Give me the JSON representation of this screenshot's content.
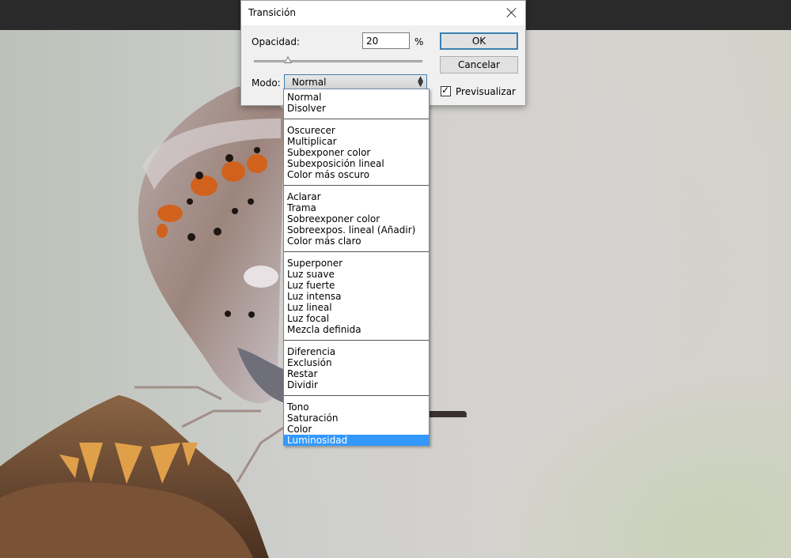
{
  "dialog": {
    "title": "Transición",
    "opacity_label": "Opacidad:",
    "opacity_value": "20",
    "opacity_unit": "%",
    "slider_fraction": 0.2,
    "mode_label": "Modo:",
    "mode_selected": "Normal",
    "ok_label": "OK",
    "cancel_label": "Cancelar",
    "preview_label": "Previsualizar",
    "preview_checked": true
  },
  "dropdown": {
    "groups": [
      [
        "Normal",
        "Disolver"
      ],
      [
        "Oscurecer",
        "Multiplicar",
        "Subexponer color",
        "Subexposición lineal",
        "Color más oscuro"
      ],
      [
        "Aclarar",
        "Trama",
        "Sobreexponer color",
        "Sobreexpos. lineal (Añadir)",
        "Color más claro"
      ],
      [
        "Superponer",
        "Luz suave",
        "Luz fuerte",
        "Luz intensa",
        "Luz lineal",
        "Luz focal",
        "Mezcla definida"
      ],
      [
        "Diferencia",
        "Exclusión",
        "Restar",
        "Dividir"
      ],
      [
        "Tono",
        "Saturación",
        "Color",
        "Luminosidad"
      ]
    ],
    "highlighted": "Luminosidad",
    "highlight_color": "#3399ff"
  },
  "icons": {
    "close": "close-icon",
    "select_arrow": "updown-arrow-icon",
    "checkmark": "checkmark-icon"
  }
}
